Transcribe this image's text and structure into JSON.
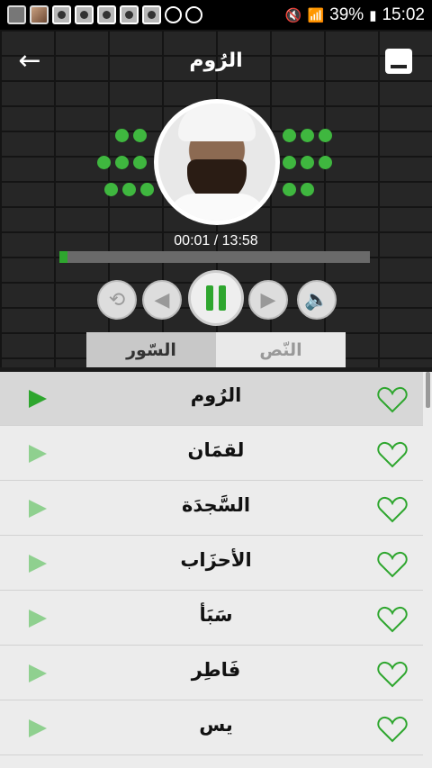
{
  "status": {
    "battery": "39%",
    "clock": "15:02"
  },
  "header": {
    "back_icon": "arrow-left-icon",
    "title": "الرُوم",
    "minimize_icon": "minimize-icon"
  },
  "player": {
    "elapsed_total": "00:01 / 13:58",
    "progress": 0.025,
    "colors": {
      "accent": "#2ea62e"
    }
  },
  "tabs": [
    {
      "label": "السّور"
    },
    {
      "label": "النّص"
    }
  ],
  "surahs": [
    {
      "name": "الرُوم"
    },
    {
      "name": "لقمَان"
    },
    {
      "name": "السَّجدَة"
    },
    {
      "name": "الأحزَاب"
    },
    {
      "name": "سَبَأ"
    },
    {
      "name": "فَاطِر"
    },
    {
      "name": "يس"
    }
  ]
}
